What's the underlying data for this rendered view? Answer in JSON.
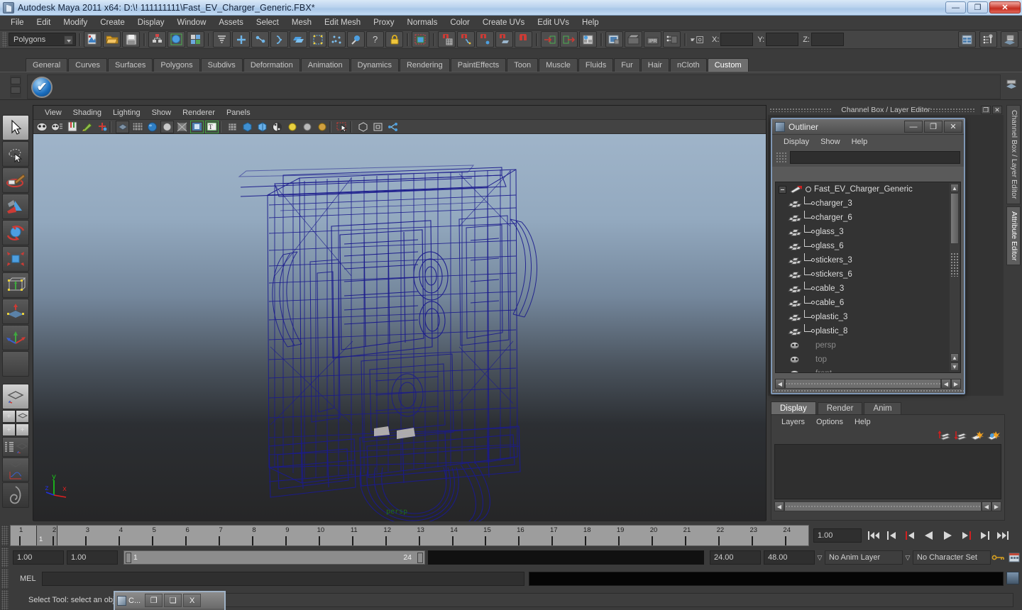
{
  "window": {
    "title": "Autodesk Maya 2011 x64: D:\\! 111111111\\Fast_EV_Charger_Generic.FBX*",
    "minimize_label": "—",
    "maximize_label": "❐",
    "close_label": "✕"
  },
  "menubar": {
    "items": [
      "File",
      "Edit",
      "Modify",
      "Create",
      "Display",
      "Window",
      "Assets",
      "Select",
      "Mesh",
      "Edit Mesh",
      "Proxy",
      "Normals",
      "Color",
      "Create UVs",
      "Edit UVs",
      "Help"
    ]
  },
  "statusline": {
    "menuset_value": "Polygons",
    "coord_labels": [
      "X:",
      "Y:",
      "Z:"
    ],
    "coord_values": [
      "",
      "",
      ""
    ],
    "icons": [
      "new-scene-icon",
      "open-scene-icon",
      "save-scene-icon",
      "select-by-hierarchy-icon",
      "select-by-object-icon",
      "select-by-component-icon",
      "select-mask-icon",
      "snap-to-grid-icon",
      "snap-to-curve-icon",
      "snap-to-point-icon",
      "snap-to-plane-icon",
      "snap-to-view-plane-icon",
      "make-live-icon",
      "history-icon",
      "construction-history-icon",
      "render-current-frame-icon",
      "ipr-render-icon",
      "render-settings-icon",
      "lock-icon",
      "select-highlight-icon",
      "magnet-grid-icon",
      "magnet-curve-icon",
      "magnet-point-icon",
      "magnet-plane-icon",
      "magnet-view-icon",
      "input-connections-icon",
      "output-connections-icon",
      "construction-history-toggle-icon",
      "render-view-icon",
      "render-sequence-icon",
      "ipr-icon",
      "render-globals-icon",
      "toggle-field-icon",
      "channel-box-icon",
      "attribute-editor-icon",
      "tool-settings-icon"
    ]
  },
  "shelf": {
    "tabs": [
      "General",
      "Curves",
      "Surfaces",
      "Polygons",
      "Subdivs",
      "Deformation",
      "Animation",
      "Dynamics",
      "Rendering",
      "PaintEffects",
      "Toon",
      "Muscle",
      "Fluids",
      "Fur",
      "Hair",
      "nCloth",
      "Custom"
    ],
    "active_tab": "Custom",
    "items": [
      {
        "name": "blue-check-shelf-button"
      }
    ]
  },
  "toolbox": {
    "items": [
      {
        "name": "select-tool",
        "selected": true
      },
      {
        "name": "lasso-select-tool",
        "selected": false
      },
      {
        "name": "paint-select-tool",
        "selected": false
      },
      {
        "name": "move-tool",
        "selected": false
      },
      {
        "name": "rotate-tool",
        "selected": false
      },
      {
        "name": "scale-tool",
        "selected": false
      },
      {
        "name": "universal-manipulator-tool",
        "selected": false
      },
      {
        "name": "soft-modification-tool",
        "selected": false
      },
      {
        "name": "show-manipulator-tool",
        "selected": false
      },
      {
        "name": "last-tool-used",
        "selected": false
      }
    ],
    "layouts": [
      {
        "name": "single-perspective-layout",
        "selected": true
      },
      {
        "name": "four-view-layout",
        "selected": false
      },
      {
        "name": "outliner-persp-layout",
        "selected": false
      },
      {
        "name": "persp-graph-layout",
        "selected": false
      },
      {
        "name": "hypershade-persp-layout",
        "selected": false
      }
    ]
  },
  "viewport": {
    "menus": [
      "View",
      "Shading",
      "Lighting",
      "Show",
      "Renderer",
      "Panels"
    ],
    "camera_label": "persp",
    "axis_labels": {
      "x": "x",
      "y": "y",
      "z": "z"
    },
    "toolbar_icons": [
      "select-camera-icon",
      "camera-attributes-icon",
      "bookmark-icon",
      "paint-icon",
      "keyframe-icon",
      "smooth-shade-icon",
      "wireframe-on-shaded-icon",
      "texture-icon",
      "lights-icon",
      "shadows-icon",
      "xray-icon",
      "xray-joints-icon",
      "grid-icon",
      "film-gate-icon",
      "resolution-gate-icon",
      "isolate-select-icon",
      "exposure-icon",
      "gamma-icon",
      "ibl-icon",
      "single-pane-icon",
      "two-pane-icon",
      "dynamics-icon"
    ],
    "model_name": "Fast_EV_Charger_Generic wireframe",
    "wireframe_color": "#1b1b8c",
    "background_top": "#9fb4c9",
    "background_bottom": "#262627"
  },
  "outliner": {
    "title": "Outliner",
    "window_buttons": {
      "min": "—",
      "max": "❐",
      "close": "✕"
    },
    "menus": [
      "Display",
      "Show",
      "Help"
    ],
    "search_value": "",
    "root": {
      "label": "Fast_EV_Charger_Generic",
      "expanded": true
    },
    "children": [
      {
        "label": "charger_3",
        "icon": "mesh-icon",
        "dim": false
      },
      {
        "label": "charger_6",
        "icon": "mesh-icon",
        "dim": false
      },
      {
        "label": "glass_3",
        "icon": "mesh-icon",
        "dim": false
      },
      {
        "label": "glass_6",
        "icon": "mesh-icon",
        "dim": false
      },
      {
        "label": "stickers_3",
        "icon": "mesh-icon",
        "dim": false
      },
      {
        "label": "stickers_6",
        "icon": "mesh-icon",
        "dim": false
      },
      {
        "label": "cable_3",
        "icon": "mesh-icon",
        "dim": false
      },
      {
        "label": "cable_6",
        "icon": "mesh-icon",
        "dim": false
      },
      {
        "label": "plastic_3",
        "icon": "mesh-icon",
        "dim": false
      },
      {
        "label": "plastic_8",
        "icon": "mesh-icon",
        "dim": false
      }
    ],
    "cameras": [
      {
        "label": "persp",
        "icon": "camera-icon",
        "dim": true
      },
      {
        "label": "top",
        "icon": "camera-icon",
        "dim": true
      },
      {
        "label": "front",
        "icon": "camera-icon",
        "dim": true
      }
    ]
  },
  "channel_panel": {
    "title": "Channel Box / Layer Editor",
    "buttons": {
      "undock": "❐",
      "close": "✕"
    }
  },
  "layer_editor": {
    "tabs": [
      "Display",
      "Render",
      "Anim"
    ],
    "active_tab": "Display",
    "menus": [
      "Layers",
      "Options",
      "Help"
    ],
    "icons": [
      "move-layer-up-icon",
      "move-layer-down-icon",
      "new-layer-icon",
      "new-layer-from-selected-icon"
    ],
    "layers": []
  },
  "right_tabs": {
    "items": [
      "Channel Box / Layer Editor",
      "Attribute Editor"
    ],
    "active": "Attribute Editor"
  },
  "timeline": {
    "ticks": [
      1,
      2,
      3,
      4,
      5,
      6,
      7,
      8,
      9,
      10,
      11,
      12,
      13,
      14,
      15,
      16,
      17,
      18,
      19,
      20,
      21,
      22,
      23,
      24
    ],
    "current_frame_marker": "1",
    "current_frame_field": "1.00",
    "playback_buttons": [
      "go-to-start-icon",
      "step-back-keyframe-icon",
      "step-back-frame-icon",
      "play-backwards-icon",
      "play-forwards-icon",
      "step-forward-frame-icon",
      "step-forward-keyframe-icon",
      "go-to-end-icon"
    ]
  },
  "range_slider": {
    "anim_start": "1.00",
    "anim_end": "1.00",
    "range_start_label": "1",
    "range_end_label": "24",
    "playback_end": "24.00",
    "anim_end_field": "48.00",
    "anim_layer": "No Anim Layer",
    "character_set": "No Character Set",
    "icons": [
      "auto-key-icon",
      "animation-preferences-icon"
    ]
  },
  "command_line": {
    "label": "MEL",
    "input_value": "",
    "output_value": "",
    "script_editor_icon": "script-editor-icon"
  },
  "help_line": {
    "text": "Select Tool: select an object",
    "field_value": ""
  },
  "taskbar_popup": {
    "icon": "maya-doc-icon",
    "title": "C...",
    "restore_label": "❐",
    "maximize_label": "❏",
    "close_label": "X"
  }
}
